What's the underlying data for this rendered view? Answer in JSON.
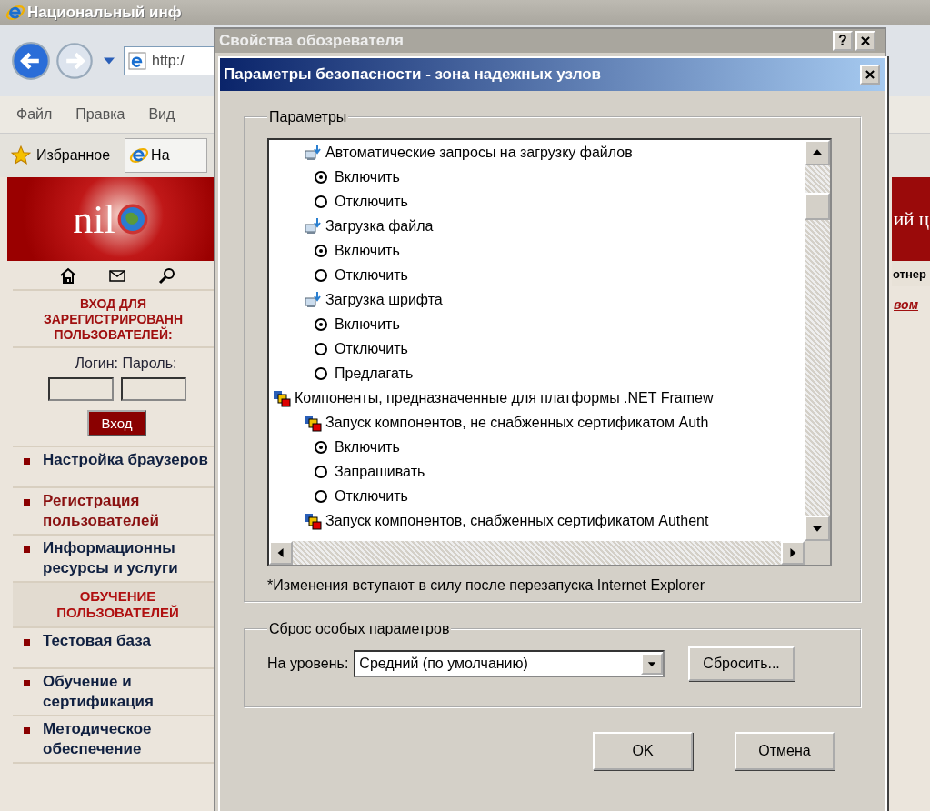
{
  "browser": {
    "title": "Национальный инф",
    "address": "http:/",
    "menu": [
      "Файл",
      "Правка",
      "Вид"
    ],
    "favorites": "Избранное",
    "tab": "На"
  },
  "site": {
    "logo": "nil",
    "login": {
      "heading": "ВХОД ДЛЯ\nЗАРЕГИСТРИРОВАНН\nПОЛЬЗОВАТЕЛЕЙ:",
      "login_label": "Логин:",
      "password_label": "Пароль:",
      "submit": "Вход"
    },
    "nav": [
      {
        "kind": "link",
        "label": "Настройка браузеров",
        "selected": false
      },
      {
        "kind": "link",
        "label": "Регистрация пользователей",
        "selected": true
      },
      {
        "kind": "link",
        "label": "Информационны ресурсы и услуги",
        "selected": false
      },
      {
        "kind": "heading",
        "label": "ОБУЧЕНИЕ ПОЛЬЗОВАТЕЛЕЙ"
      },
      {
        "kind": "link",
        "label": "Тестовая база",
        "selected": false
      },
      {
        "kind": "link",
        "label": "Обучение и сертификация",
        "selected": false
      },
      {
        "kind": "link",
        "label": "Методическое обеспечение",
        "selected": false
      }
    ],
    "banner_text": "ий ц",
    "toolbar_text": "отнер",
    "link": "вом"
  },
  "internet_options": {
    "title": "Свойства обозревателя",
    "help": "?"
  },
  "security_settings": {
    "title": "Параметры безопасности - зона надежных узлов",
    "group_label": "Параметры",
    "tree": [
      {
        "kind": "setting",
        "label": "Автоматические запросы на загрузку файлов",
        "options": [
          {
            "label": "Включить",
            "selected": true
          },
          {
            "label": "Отключить",
            "selected": false
          }
        ]
      },
      {
        "kind": "setting",
        "label": "Загрузка файла",
        "options": [
          {
            "label": "Включить",
            "selected": true
          },
          {
            "label": "Отключить",
            "selected": false
          }
        ]
      },
      {
        "kind": "setting",
        "label": "Загрузка шрифта",
        "options": [
          {
            "label": "Включить",
            "selected": true
          },
          {
            "label": "Отключить",
            "selected": false
          },
          {
            "label": "Предлагать",
            "selected": false
          }
        ]
      },
      {
        "kind": "group",
        "label": "Компоненты, предназначенные для платформы .NET Framew",
        "children": [
          {
            "kind": "component",
            "label": "Запуск компонентов, не снабженных сертификатом Auth",
            "options": [
              {
                "label": "Включить",
                "selected": true
              },
              {
                "label": "Запрашивать",
                "selected": false
              },
              {
                "label": "Отключить",
                "selected": false
              }
            ]
          },
          {
            "kind": "component",
            "label": "Запуск компонентов, снабженных сертификатом Authent"
          }
        ]
      }
    ],
    "note": "*Изменения вступают в силу после перезапуска Internet Explorer",
    "reset": {
      "label": "Сброс особых параметров",
      "level_label": "На уровень:",
      "level_value": "Средний (по умолчанию)",
      "button": "Сбросить..."
    },
    "buttons": [
      "OK",
      "Отмена"
    ]
  }
}
